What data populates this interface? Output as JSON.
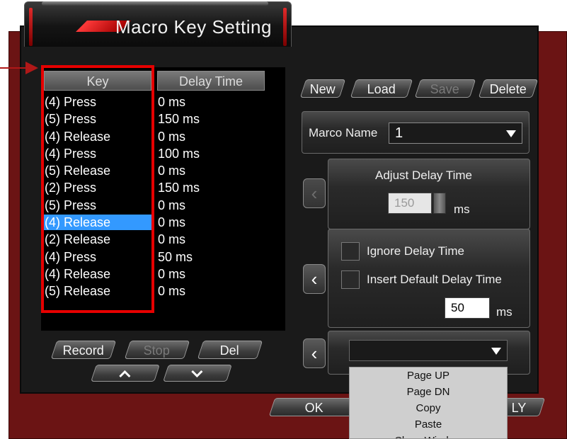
{
  "window": {
    "title": "Macro Key Setting"
  },
  "list": {
    "headers": {
      "key": "Key",
      "delay": "Delay Time"
    },
    "rows": [
      {
        "key": "(4) Press",
        "delay": "0 ms"
      },
      {
        "key": "(5) Press",
        "delay": "150 ms"
      },
      {
        "key": "(4) Release",
        "delay": "0 ms"
      },
      {
        "key": "(4) Press",
        "delay": "100 ms"
      },
      {
        "key": "(5) Release",
        "delay": "0 ms"
      },
      {
        "key": "(2) Press",
        "delay": "150 ms"
      },
      {
        "key": "(5) Press",
        "delay": "0 ms"
      },
      {
        "key": "(4) Release",
        "delay": "0 ms",
        "selected": true
      },
      {
        "key": "(2) Release",
        "delay": "0 ms"
      },
      {
        "key": "(4) Press",
        "delay": "50 ms"
      },
      {
        "key": "(4) Release",
        "delay": "0 ms"
      },
      {
        "key": "(5) Release",
        "delay": "0 ms"
      }
    ]
  },
  "list_buttons": {
    "record": "Record",
    "stop": "Stop",
    "del": "Del",
    "up_icon": "chevron-up-icon",
    "down_icon": "chevron-down-icon"
  },
  "macro_buttons": {
    "new": "New",
    "load": "Load",
    "save": "Save",
    "delete": "Delete"
  },
  "macro_name": {
    "label": "Marco Name",
    "value": "1"
  },
  "adjust_delay": {
    "label": "Adjust Delay Time",
    "value": "150",
    "unit": "ms"
  },
  "delay_options": {
    "ignore": "Ignore Delay Time",
    "insert_default": "Insert Default Delay Time",
    "default_value": "50",
    "unit": "ms"
  },
  "command_combo": {
    "value": ""
  },
  "dropdown": {
    "items": [
      "Page UP",
      "Page DN",
      "Copy",
      "Paste",
      "Close Window"
    ]
  },
  "footer": {
    "ok": "OK",
    "apply": "LY"
  },
  "colors": {
    "accent_red": "#e60000",
    "selection": "#3399ff",
    "frame": "#6b1414"
  }
}
